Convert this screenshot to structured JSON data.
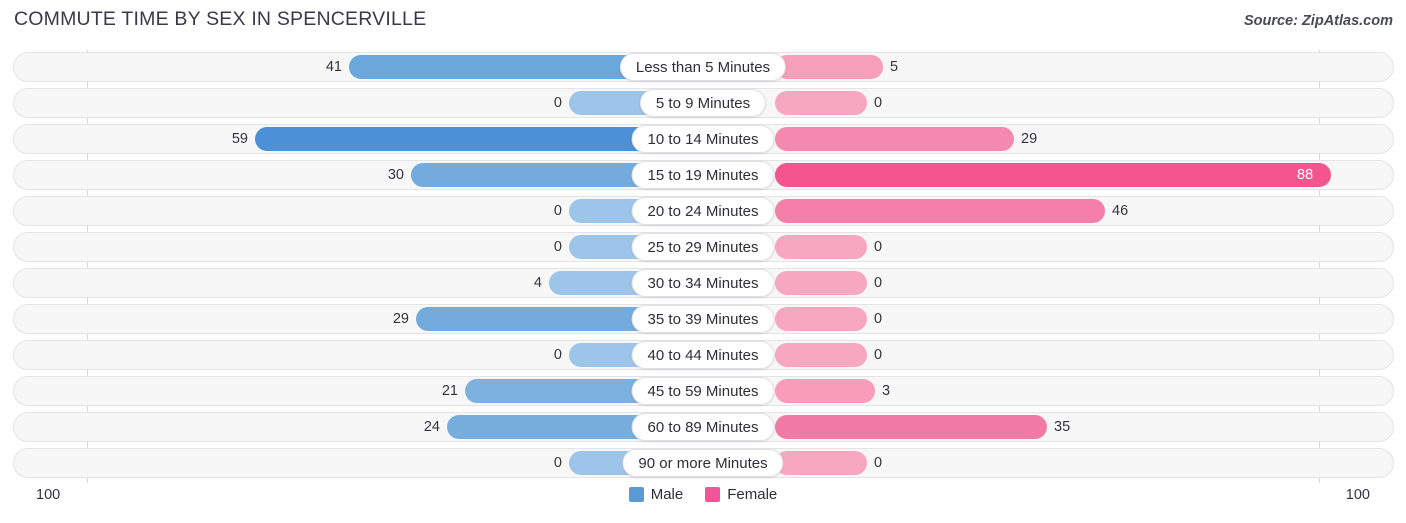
{
  "header": {
    "title": "COMMUTE TIME BY SEX IN SPENCERVILLE",
    "source": "Source: ZipAtlas.com"
  },
  "axis": {
    "left_end_label": "100",
    "right_end_label": "100"
  },
  "legend": {
    "items": [
      {
        "label": "Male",
        "color": "#5b9bd5"
      },
      {
        "label": "Female",
        "color": "#f2549a"
      }
    ]
  },
  "colors": {
    "male_strong": "#5292d4",
    "male_light": "#8dbce8",
    "female_strong": "#f4558f",
    "female_mid": "#f27ba6",
    "female_light": "#f79ebb",
    "track": "#f7f7f8"
  },
  "chart_data": {
    "type": "bar",
    "orientation": "horizontal-diverging",
    "title": "COMMUTE TIME BY SEX IN SPENCERVILLE",
    "xlabel": "",
    "ylabel": "",
    "xlim": [
      100,
      100
    ],
    "grid": false,
    "legend_position": "bottom-center",
    "categories": [
      "Less than 5 Minutes",
      "5 to 9 Minutes",
      "10 to 14 Minutes",
      "15 to 19 Minutes",
      "20 to 24 Minutes",
      "25 to 29 Minutes",
      "30 to 34 Minutes",
      "35 to 39 Minutes",
      "40 to 44 Minutes",
      "45 to 59 Minutes",
      "60 to 89 Minutes",
      "90 or more Minutes"
    ],
    "series": [
      {
        "name": "Male",
        "values": [
          41,
          0,
          59,
          30,
          0,
          0,
          4,
          29,
          0,
          21,
          24,
          0
        ]
      },
      {
        "name": "Female",
        "values": [
          5,
          0,
          29,
          88,
          46,
          0,
          0,
          0,
          0,
          3,
          35,
          0
        ]
      }
    ]
  },
  "rows": [
    {
      "category": "Less than 5 Minutes",
      "male": "41",
      "female": "5",
      "male_len": 312,
      "female_len": 108,
      "male_color": "#6aa7db",
      "female_color": "#f79ebb",
      "female_inside": false
    },
    {
      "category": "5 to 9 Minutes",
      "male": "0",
      "female": "0",
      "male_len": 92,
      "female_len": 92,
      "male_color": "#9dc5ea",
      "female_color": "#f8a7c1",
      "female_inside": false
    },
    {
      "category": "10 to 14 Minutes",
      "male": "59",
      "female": "29",
      "male_len": 406,
      "female_len": 239,
      "male_color": "#4c90d6",
      "female_color": "#f589b0",
      "female_inside": false
    },
    {
      "category": "15 to 19 Minutes",
      "male": "30",
      "female": "88",
      "male_len": 250,
      "female_len": 556,
      "male_color": "#74abdd",
      "female_color": "#f4558f",
      "female_inside": true
    },
    {
      "category": "20 to 24 Minutes",
      "male": "0",
      "female": "46",
      "male_len": 92,
      "female_len": 330,
      "male_color": "#9dc5ea",
      "female_color": "#f47fa9",
      "female_inside": false
    },
    {
      "category": "25 to 29 Minutes",
      "male": "0",
      "female": "0",
      "male_len": 92,
      "female_len": 92,
      "male_color": "#9dc5ea",
      "female_color": "#f8a7c1",
      "female_inside": false
    },
    {
      "category": "30 to 34 Minutes",
      "male": "4",
      "female": "0",
      "male_len": 112,
      "female_len": 92,
      "male_color": "#9dc5ea",
      "female_color": "#f8a7c1",
      "female_inside": false
    },
    {
      "category": "35 to 39 Minutes",
      "male": "29",
      "female": "0",
      "male_len": 245,
      "female_len": 92,
      "male_color": "#74abdd",
      "female_color": "#f8a7c1",
      "female_inside": false
    },
    {
      "category": "40 to 44 Minutes",
      "male": "0",
      "female": "0",
      "male_len": 92,
      "female_len": 92,
      "male_color": "#9dc5ea",
      "female_color": "#f8a7c1",
      "female_inside": false
    },
    {
      "category": "45 to 59 Minutes",
      "male": "21",
      "female": "3",
      "male_len": 196,
      "female_len": 100,
      "male_color": "#7cb0df",
      "female_color": "#f89cb9",
      "female_inside": false
    },
    {
      "category": "60 to 89 Minutes",
      "male": "24",
      "female": "35",
      "male_len": 214,
      "female_len": 272,
      "male_color": "#78aede",
      "female_color": "#f27ba6",
      "female_inside": false
    },
    {
      "category": "90 or more Minutes",
      "male": "0",
      "female": "0",
      "male_len": 92,
      "female_len": 92,
      "male_color": "#9dc5ea",
      "female_color": "#f8a7c1",
      "female_inside": false
    }
  ]
}
